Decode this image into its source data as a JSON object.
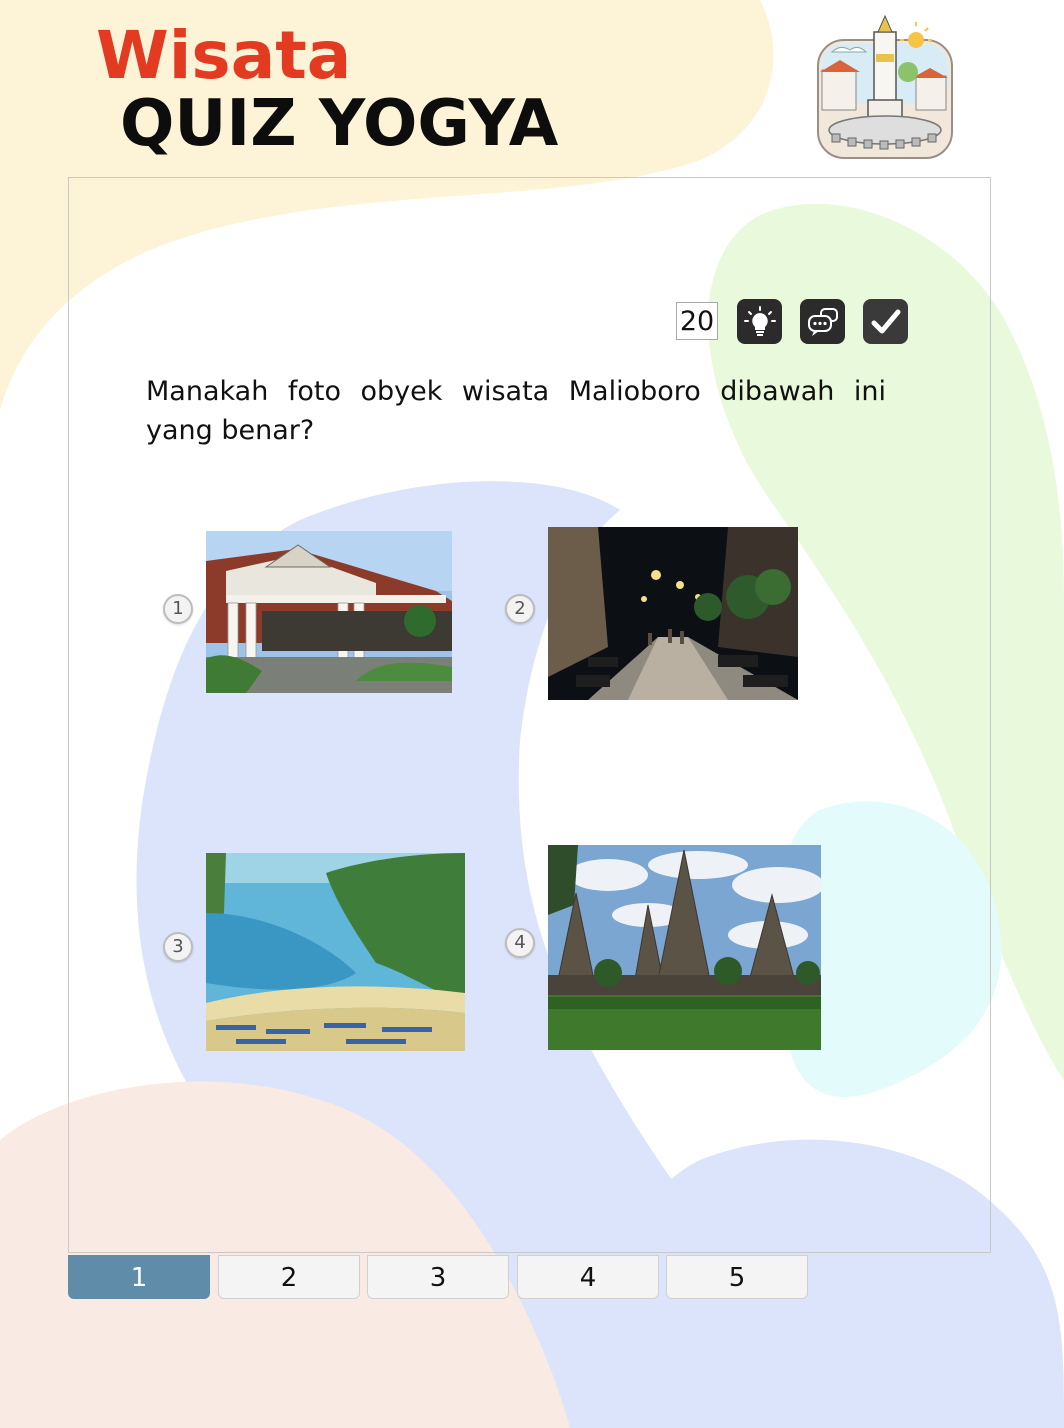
{
  "header": {
    "title_top": "Wisata",
    "title_main": "QUIZ YOGYA",
    "logo_icon": "tugu-yogyakarta-icon"
  },
  "toolbar": {
    "counter": "20",
    "hint_icon": "lightbulb-icon",
    "chat_icon": "chat-bubbles-icon",
    "check_icon": "checkmark-icon"
  },
  "question": {
    "text": "Manakah foto obyek wisata Malioboro dibawah ini yang benar?"
  },
  "options": [
    {
      "number": "1",
      "image": "keraton-palace-photo"
    },
    {
      "number": "2",
      "image": "malioboro-street-night-photo"
    },
    {
      "number": "3",
      "image": "beach-bay-photo"
    },
    {
      "number": "4",
      "image": "prambanan-temple-photo"
    }
  ],
  "pagination": {
    "tabs": [
      "1",
      "2",
      "3",
      "4",
      "5"
    ],
    "active": "1"
  },
  "colors": {
    "title_red": "#e23b22",
    "active_tab": "#5f8ca8",
    "bg_cream": "#fdf3d6",
    "bg_blue": "#dbe4fb",
    "bg_green": "#e9f9dc",
    "bg_peach": "#f9ebe4"
  }
}
